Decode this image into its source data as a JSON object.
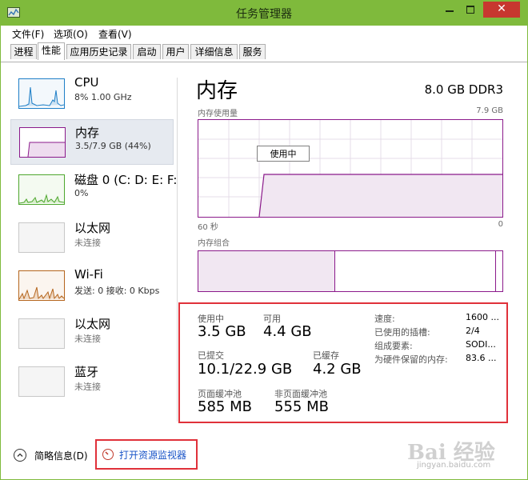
{
  "window": {
    "title": "任务管理器",
    "close_glyph": "✕"
  },
  "menu": [
    "文件(F)",
    "选项(O)",
    "查看(V)"
  ],
  "tabs": [
    "进程",
    "性能",
    "应用历史记录",
    "启动",
    "用户",
    "详细信息",
    "服务"
  ],
  "active_tab": 1,
  "resources": [
    {
      "name": "CPU",
      "sub": "8% 1.00 GHz",
      "selected": false
    },
    {
      "name": "内存",
      "sub": "3.5/7.9 GB (44%)",
      "selected": true
    },
    {
      "name": "磁盘 0 (C: D: E: F:",
      "sub": "0%",
      "selected": false
    },
    {
      "name": "以太网",
      "sub": "未连接",
      "selected": false
    },
    {
      "name": "Wi-Fi",
      "sub": "发送: 0 接收: 0 Kbps",
      "selected": false
    },
    {
      "name": "以太网",
      "sub": "未连接",
      "selected": false
    },
    {
      "name": "蓝牙",
      "sub": "未连接",
      "selected": false
    }
  ],
  "panel": {
    "title": "内存",
    "spec": "8.0 GB DDR3",
    "usage_label": "内存使用量",
    "usage_max": "7.9 GB",
    "time_left": "60 秒",
    "time_right": "0",
    "tooltip": "使用中",
    "composition_label": "内存组合"
  },
  "stats": {
    "in_use_label": "使用中",
    "in_use": "3.5 GB",
    "available_label": "可用",
    "available": "4.4 GB",
    "committed_label": "已提交",
    "committed": "10.1/22.9 GB",
    "cached_label": "已缓存",
    "cached": "4.2 GB",
    "paged_label": "页面缓冲池",
    "paged": "585 MB",
    "nonpaged_label": "非页面缓冲池",
    "nonpaged": "555 MB"
  },
  "details": [
    {
      "k": "速度:",
      "v": "1600 ..."
    },
    {
      "k": "已使用的插槽:",
      "v": "2/4"
    },
    {
      "k": "组成要素:",
      "v": "SODI..."
    },
    {
      "k": "为硬件保留的内存:",
      "v": "83.6 ..."
    }
  ],
  "bottom": {
    "fewer": "简略信息(D)",
    "monitor": "打开资源监视器"
  },
  "watermark": {
    "logo": "Bai 经验",
    "url": "jingyan.baidu.com"
  },
  "colors": {
    "titlebar": "#7fba3c",
    "memory_accent": "#8b1a8b",
    "cpu_accent": "#1e7fc7",
    "disk_accent": "#4ea72e",
    "wifi_accent": "#b5651d",
    "highlight": "#e0313a"
  }
}
